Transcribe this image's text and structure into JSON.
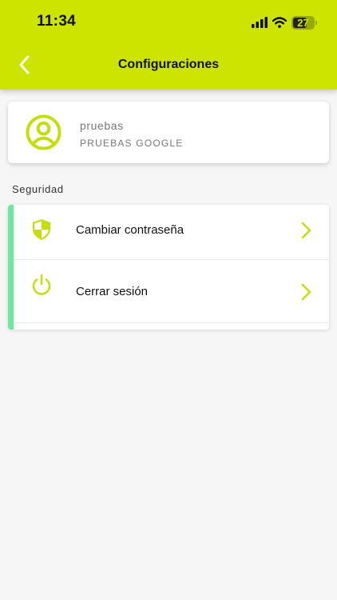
{
  "status_bar": {
    "time": "11:34",
    "battery_level": "27",
    "icons": [
      "signal-icon",
      "wifi-icon",
      "battery-icon"
    ]
  },
  "header": {
    "title": "Configuraciones",
    "back_icon": "chevron-left-icon"
  },
  "profile": {
    "name": "pruebas",
    "subtitle": "PRUEBAS GOOGLE",
    "avatar_icon": "user-circle-icon"
  },
  "security": {
    "section_label": "Seguridad",
    "items": [
      {
        "label": "Cambiar contraseña",
        "icon": "shield-icon"
      },
      {
        "label": "Cerrar sesión",
        "icon": "power-icon"
      }
    ]
  },
  "colors": {
    "brand": "#cde300",
    "accent": "#6ee7a0",
    "icon": "#c6dd0c",
    "background": "#f6f6f6"
  }
}
